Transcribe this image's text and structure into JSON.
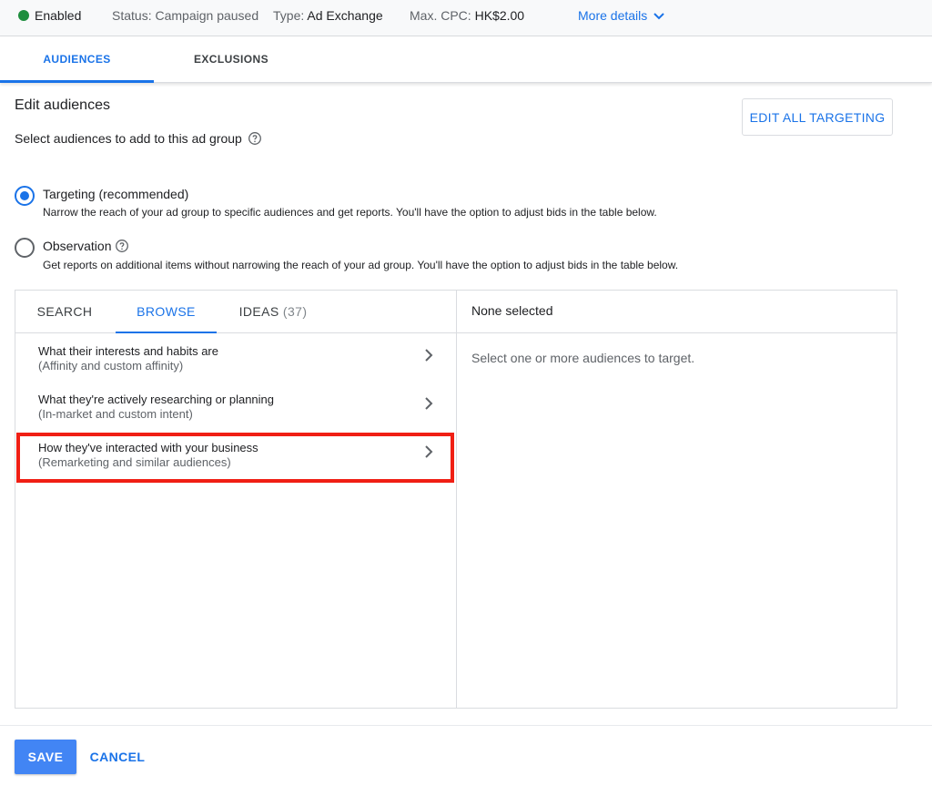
{
  "topbar": {
    "status_label": "Enabled",
    "status_color": "#1e8e3e",
    "campaign_status_label": "Status:",
    "campaign_status_value": "Campaign paused",
    "type_label": "Type:",
    "type_value": "Ad Exchange",
    "cpc_label": "Max. CPC:",
    "cpc_value": "HK$2.00",
    "more_details": "More details",
    "more_details_icon": "chevron-down-icon"
  },
  "tabs": [
    {
      "label": "AUDIENCES",
      "active": true
    },
    {
      "label": "EXCLUSIONS",
      "active": false
    }
  ],
  "edit": {
    "title": "Edit audiences",
    "subtitle": "Select audiences to add to this ad group",
    "edit_all_button": "EDIT ALL TARGETING"
  },
  "options": [
    {
      "label": "Targeting (recommended)",
      "selected": true,
      "description": "Narrow the reach of your ad group to specific audiences and get reports. You'll have the option to adjust bids in the table below."
    },
    {
      "label": "Observation",
      "selected": false,
      "description": "Get reports on additional items without narrowing the reach of your ad group. You'll have the option to adjust bids in the table below."
    }
  ],
  "panel": {
    "tabs": [
      {
        "label": "SEARCH",
        "active": false
      },
      {
        "label": "BROWSE",
        "active": true
      },
      {
        "label": "IDEAS",
        "count": "(37)",
        "active": false
      }
    ],
    "items": [
      {
        "title": "What their interests and habits are",
        "subtitle": "(Affinity and custom affinity)"
      },
      {
        "title": "What they're actively researching or planning",
        "subtitle": "(In-market and custom intent)"
      },
      {
        "title": "How they've interacted with your business",
        "subtitle": "(Remarketing and similar audiences)",
        "highlighted": true
      }
    ],
    "right_header": "None selected",
    "right_hint": "Select one or more audiences to target."
  },
  "footer": {
    "save": "SAVE",
    "cancel": "CANCEL"
  },
  "colors": {
    "accent": "#1a73e8",
    "save_button": "#4285f4",
    "highlight": "#f01f14"
  }
}
